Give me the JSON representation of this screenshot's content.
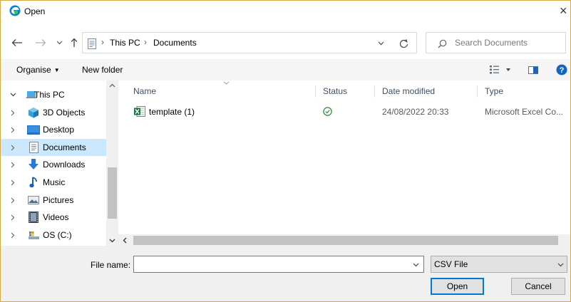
{
  "window": {
    "title": "Open",
    "close_glyph": "×"
  },
  "address": {
    "crumbs": [
      "This PC",
      "Documents"
    ],
    "search_placeholder": "Search Documents"
  },
  "toolbar": {
    "organise": "Organise",
    "new_folder": "New folder"
  },
  "tree": {
    "items": [
      {
        "label": "This PC",
        "icon": "this-pc-icon"
      },
      {
        "label": "3D Objects",
        "icon": "3d-objects-icon"
      },
      {
        "label": "Desktop",
        "icon": "desktop-icon"
      },
      {
        "label": "Documents",
        "icon": "documents-icon",
        "selected": true
      },
      {
        "label": "Downloads",
        "icon": "downloads-icon"
      },
      {
        "label": "Music",
        "icon": "music-icon"
      },
      {
        "label": "Pictures",
        "icon": "pictures-icon"
      },
      {
        "label": "Videos",
        "icon": "videos-icon"
      },
      {
        "label": "OS (C:)",
        "icon": "drive-icon"
      }
    ]
  },
  "columns": {
    "name": "Name",
    "status": "Status",
    "date": "Date modified",
    "type": "Type"
  },
  "files": [
    {
      "name": "template (1)",
      "date": "24/08/2022 20:33",
      "type": "Microsoft Excel Co..."
    }
  ],
  "footer": {
    "file_name_label": "File name:",
    "file_name_value": "",
    "filter": "CSV File",
    "open": "Open",
    "cancel": "Cancel"
  },
  "colors": {
    "accent": "#0078d7",
    "selection": "#cce8ff",
    "border": "#d6a84a",
    "bar": "#f0f0f0"
  }
}
